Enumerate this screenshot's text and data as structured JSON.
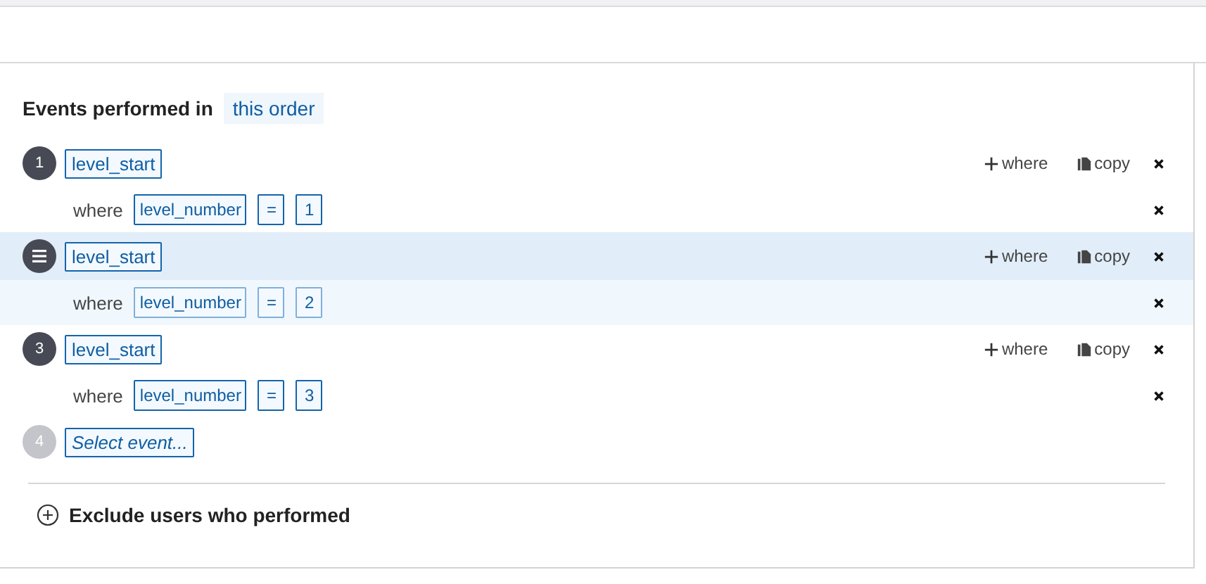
{
  "header": {
    "label": "Events performed in",
    "order": "this order"
  },
  "steps": [
    {
      "kind": "event",
      "number": "1",
      "selected": false,
      "event": "level_start",
      "add_where": "where",
      "copy": "copy",
      "where_label": "where",
      "property": "level_number",
      "operator": "=",
      "value": "1"
    },
    {
      "kind": "event",
      "selected": true,
      "event": "level_start",
      "add_where": "where",
      "copy": "copy",
      "where_label": "where",
      "property": "level_number",
      "operator": "=",
      "value": "2"
    },
    {
      "kind": "event",
      "number": "3",
      "selected": false,
      "event": "level_start",
      "add_where": "where",
      "copy": "copy",
      "where_label": "where",
      "property": "level_number",
      "operator": "=",
      "value": "3"
    },
    {
      "kind": "empty",
      "number": "4",
      "placeholder": "Select event..."
    }
  ],
  "exclude": {
    "label": "Exclude users who performed"
  }
}
